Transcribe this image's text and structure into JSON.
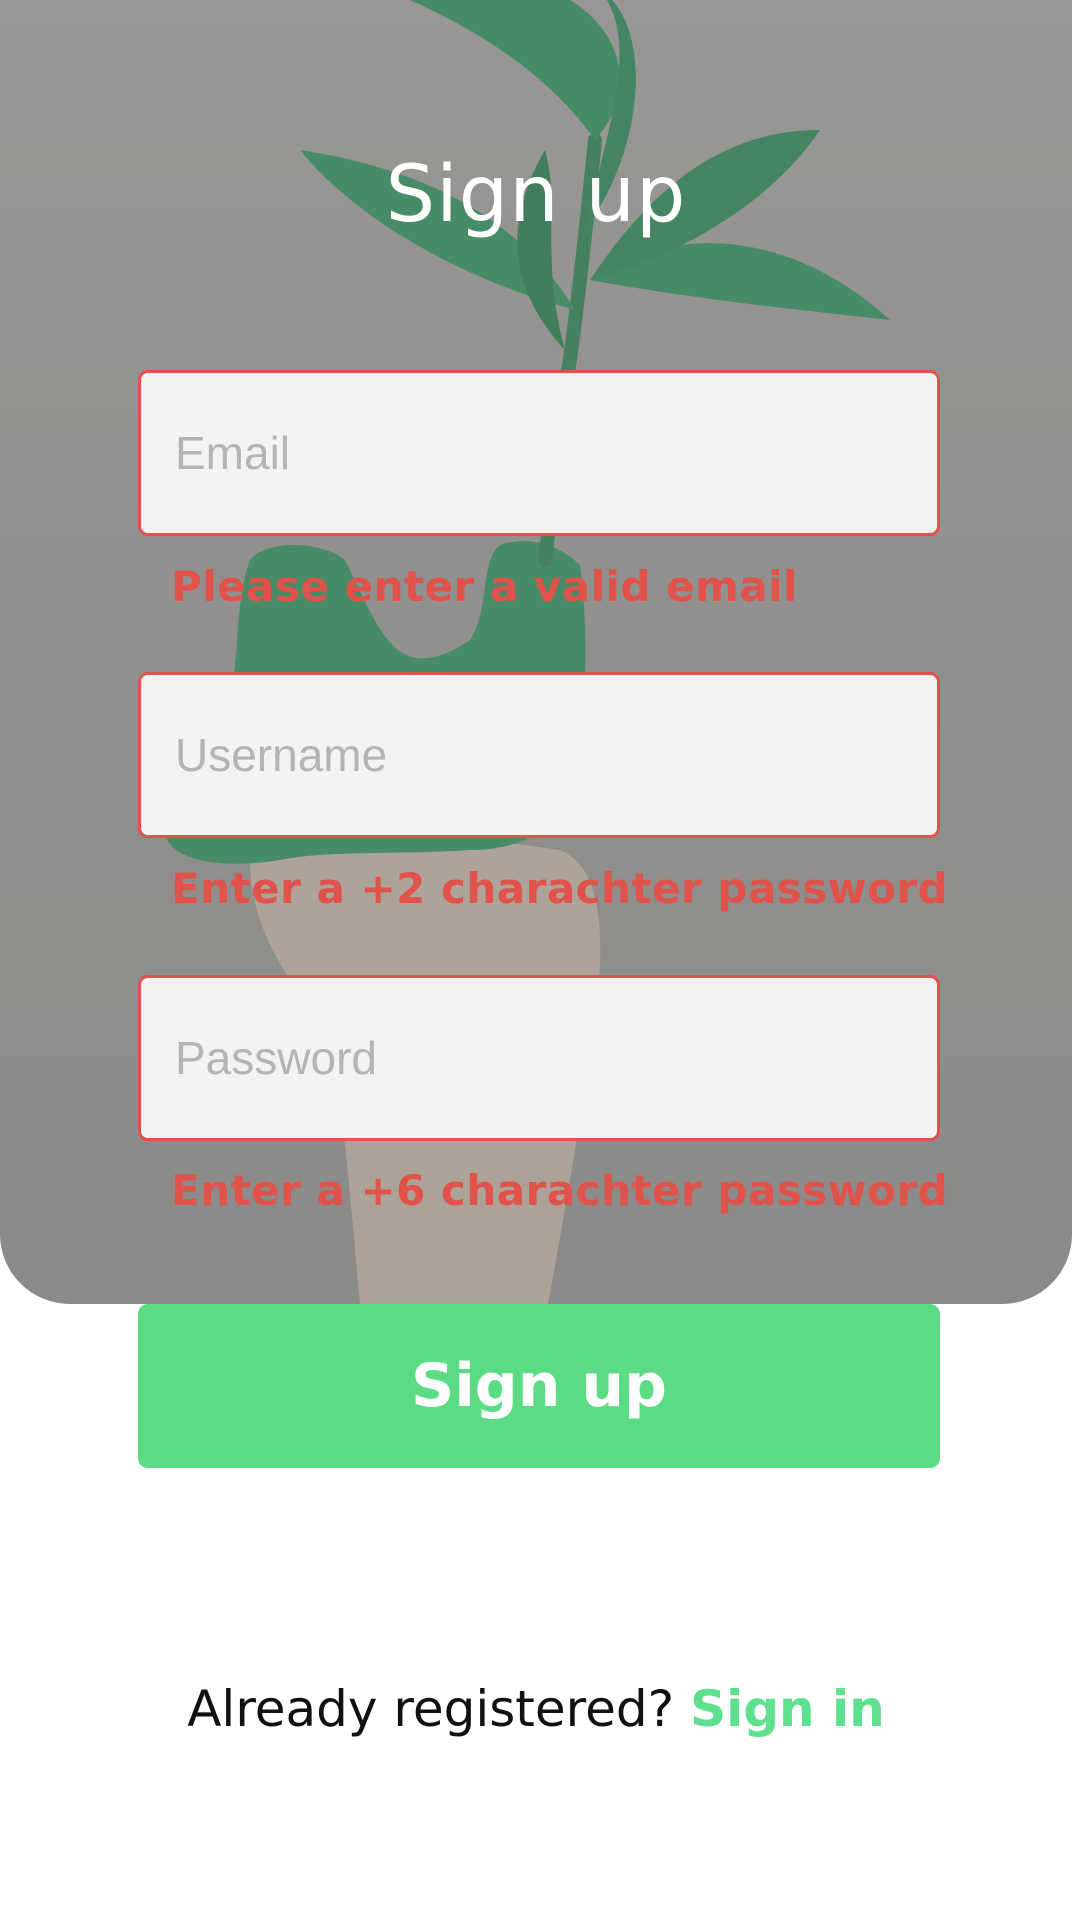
{
  "title": "Sign up",
  "form": {
    "email": {
      "value": "",
      "placeholder": "Email",
      "error": "Please enter a valid email"
    },
    "username": {
      "value": "",
      "placeholder": "Username",
      "error": "Enter a +2 charachter password"
    },
    "password": {
      "value": "",
      "placeholder": "Password",
      "error": "Enter a +6 charachter password"
    }
  },
  "submit_label": "Sign up",
  "footer": {
    "prompt": "Already registered?",
    "link_label": "Sign in"
  },
  "colors": {
    "accent": "#5bdc84",
    "error": "#e0524a",
    "link": "#5ee08e",
    "field_bg": "#f4f3f3"
  }
}
